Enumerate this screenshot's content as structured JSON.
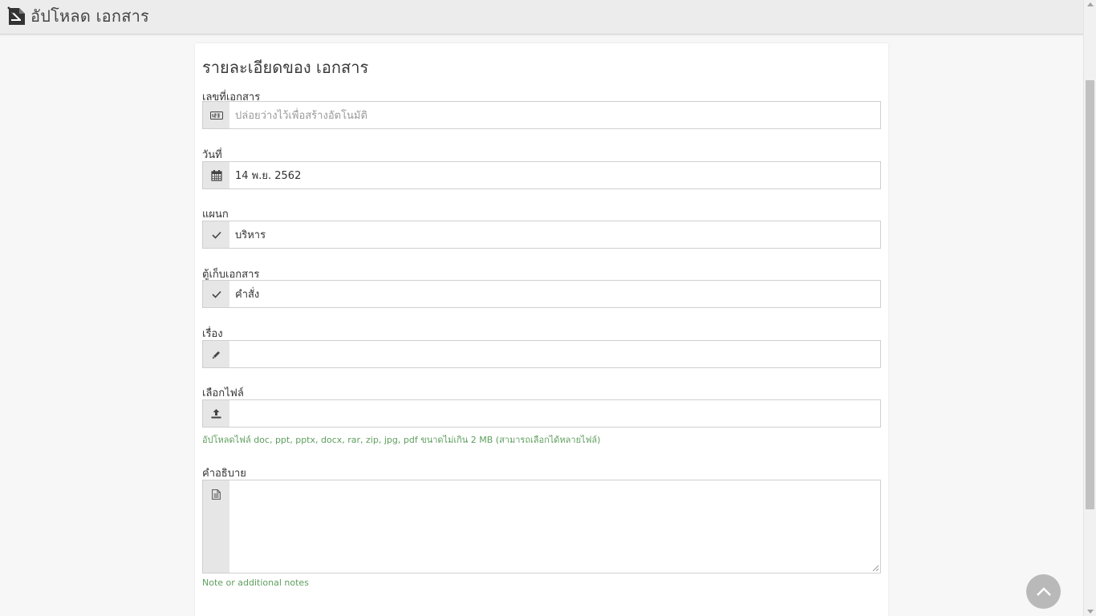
{
  "header": {
    "title": "อัปโหลด เอกสาร"
  },
  "form": {
    "title": "รายละเอียดของ เอกสาร",
    "doc_no": {
      "label": "เลขที่เอกสาร",
      "placeholder": "ปล่อยว่างไว้เพื่อสร้างอัตโนมัติ",
      "value": ""
    },
    "date": {
      "label": "วันที่",
      "value": "14 พ.ย. 2562"
    },
    "department": {
      "label": "แผนก",
      "value": "บริหาร"
    },
    "cabinet": {
      "label": "ตู้เก็บเอกสาร",
      "value": "คำสั่ง"
    },
    "subject": {
      "label": "เรื่อง",
      "value": ""
    },
    "file": {
      "label": "เลือกไฟล์",
      "value": "",
      "hint": "อัปโหลดไฟล์ doc, ppt, pptx, docx, rar, zip, jpg, pdf ขนาดไม่เกิน 2 MB (สามารถเลือกได้หลายไฟล์)"
    },
    "description": {
      "label": "คำอธิบาย",
      "value": "",
      "hint": "Note or additional notes"
    }
  },
  "icons": {
    "header": "document-upload-icon",
    "doc_no": "number-123-icon",
    "date": "calendar-icon",
    "department": "check-icon",
    "cabinet": "check-icon",
    "subject": "pencil-icon",
    "file": "upload-icon",
    "description": "file-text-icon",
    "back_to_top": "chevron-up-icon"
  },
  "colors": {
    "background": "#f7f7f7",
    "topbar": "#ececec",
    "addon": "#e6e6e6",
    "hint": "#5e9e5e",
    "back_to_top": "#b9b9b9"
  }
}
